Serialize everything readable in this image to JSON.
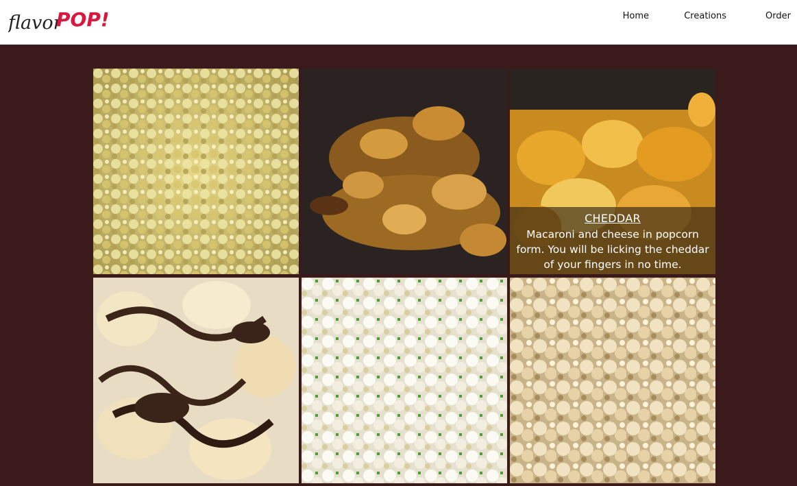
{
  "brand": {
    "logo_text_script": "flavor",
    "logo_text_bold": "POP!",
    "script_color": "#222222",
    "accent_color": "#d7193f"
  },
  "nav": {
    "items": [
      {
        "label": "Home"
      },
      {
        "label": "Creations"
      },
      {
        "label": "Order"
      }
    ]
  },
  "gallery": {
    "tiles": [
      {
        "image": "butter-popcorn",
        "hover": false
      },
      {
        "image": "caramel-nut-popcorn",
        "hover": false
      },
      {
        "image": "cheddar-popcorn",
        "hover": true,
        "title": "CHEDDAR",
        "description": "Macaroni and cheese in popcorn form. You will be licking the cheddar of your fingers in no time."
      },
      {
        "image": "chocolate-drizzle-popcorn",
        "hover": false
      },
      {
        "image": "herb-popcorn",
        "hover": false
      },
      {
        "image": "kettle-corn-popcorn",
        "hover": false
      }
    ]
  },
  "colors": {
    "page_background": "#3a1a1a",
    "header_background": "#ffffff"
  }
}
